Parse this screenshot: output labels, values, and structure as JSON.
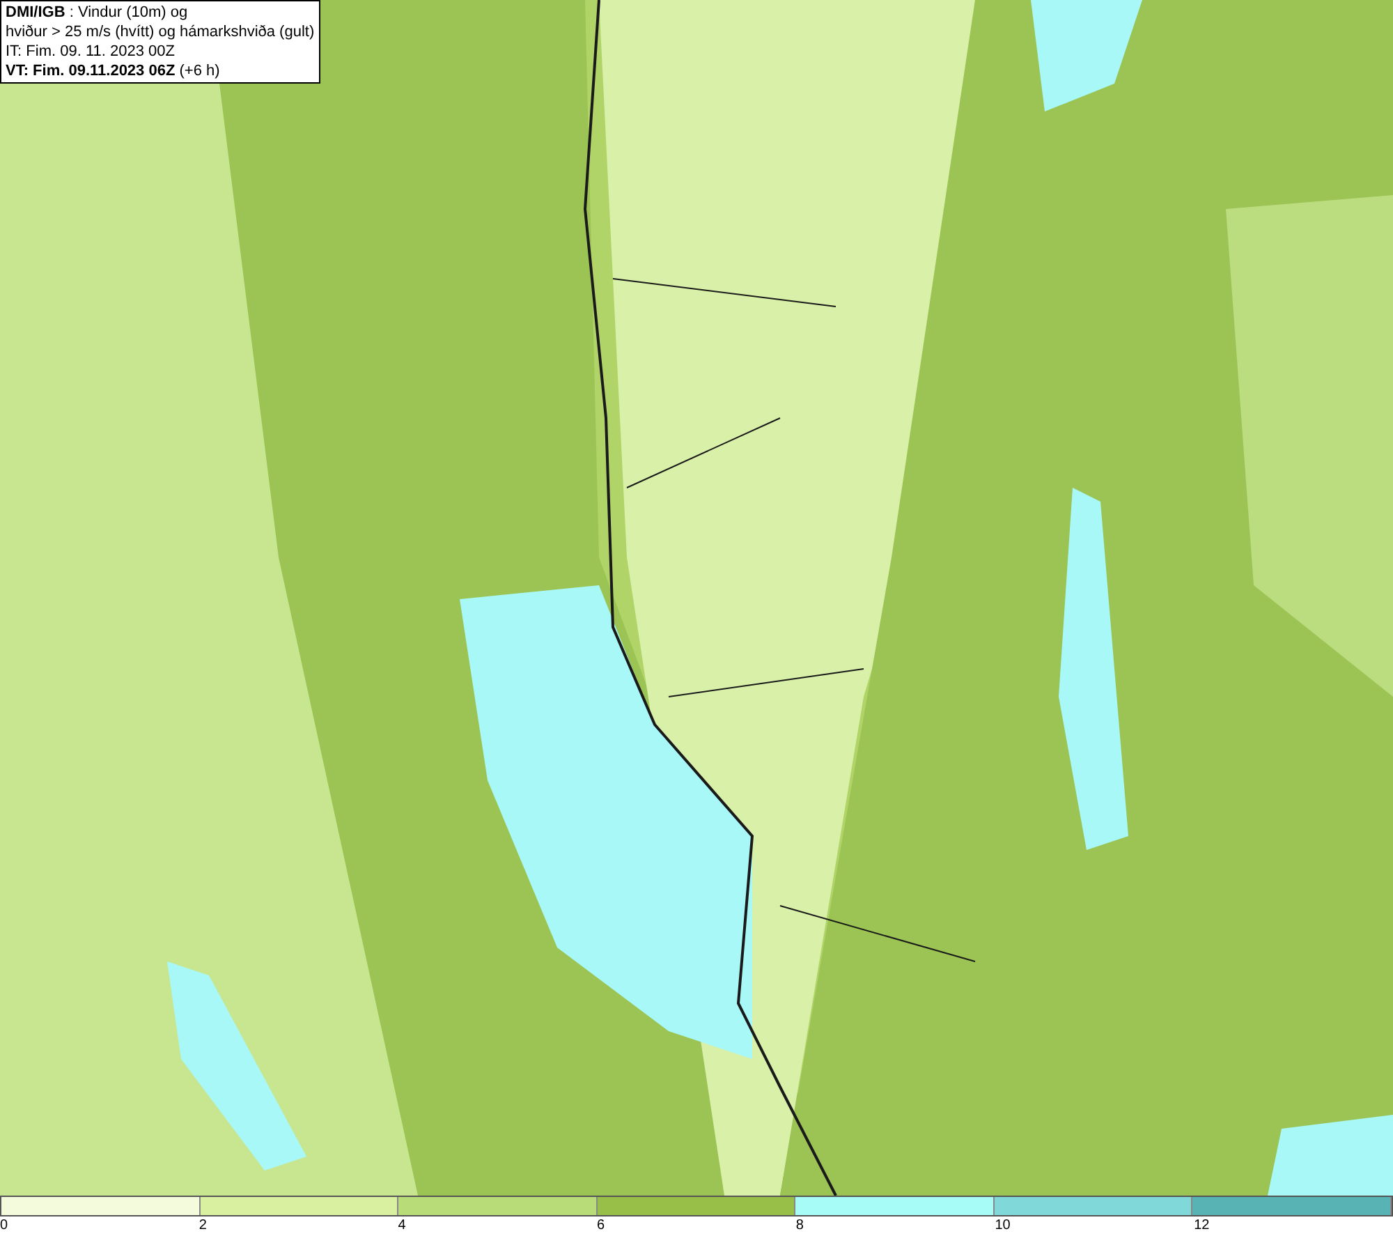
{
  "legend_box": {
    "lines": [
      "**DMI/IGB** : Vindur (10m) og",
      "hviður > 25 m/s (hvítt) og hámarkshviða (gult)",
      "IT: Fim. 09. 11. 2023 00Z",
      "**VT: Fim. 09.11.2023 06Z** (+6 h)"
    ]
  },
  "color_scale": {
    "segments": [
      {
        "color": "#f4fadc"
      },
      {
        "color": "#d8f0a0"
      },
      {
        "color": "#b8dc78"
      },
      {
        "color": "#98c048"
      },
      {
        "color": "#a8fcf8"
      },
      {
        "color": "#80d8d8"
      },
      {
        "color": "#58b4b4"
      }
    ],
    "ticks": [
      "0",
      "2",
      "4",
      "6",
      "8",
      "10",
      "12"
    ]
  }
}
